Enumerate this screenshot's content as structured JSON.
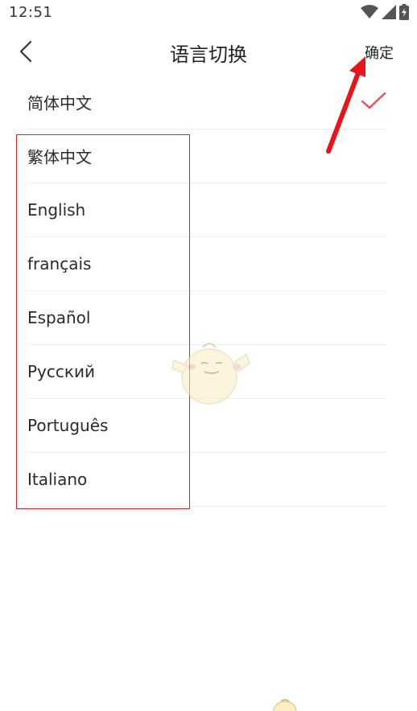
{
  "status_bar": {
    "time": "12:51",
    "icons": [
      "wifi-icon",
      "signal-icon",
      "battery-icon"
    ]
  },
  "header": {
    "title": "语言切换",
    "confirm_label": "确定",
    "back_icon": "chevron-left-icon"
  },
  "languages": [
    {
      "label": "简体中文",
      "selected": true
    },
    {
      "label": "繁体中文",
      "selected": false
    },
    {
      "label": "English",
      "selected": false
    },
    {
      "label": "français",
      "selected": false
    },
    {
      "label": "Español",
      "selected": false
    },
    {
      "label": "Русский",
      "selected": false
    },
    {
      "label": "Português",
      "selected": false
    },
    {
      "label": "Italiano",
      "selected": false
    }
  ],
  "colors": {
    "check": "#e8505b",
    "annotation_red": "#e02222",
    "divider": "#eeeeee"
  }
}
